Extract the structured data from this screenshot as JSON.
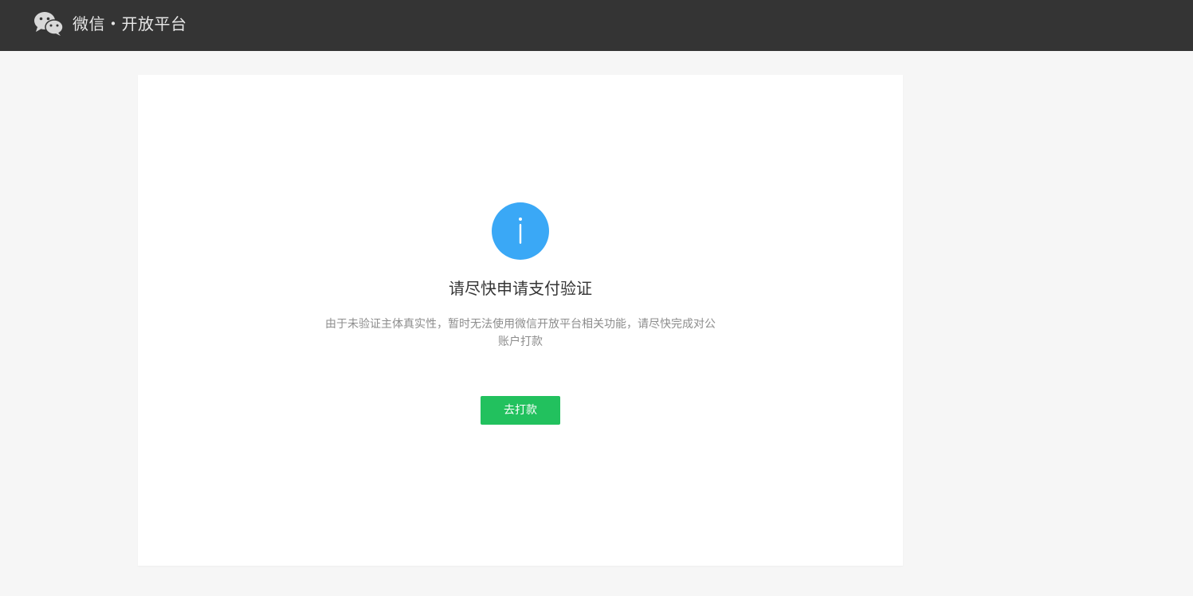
{
  "header": {
    "brand_title": "微信・开放平台",
    "logo_icon": "wechat-logo-icon"
  },
  "notice": {
    "icon": "info-icon",
    "icon_color": "#3aa8f6",
    "title": "请尽快申请支付验证",
    "description": "由于未验证主体真实性，暂时无法使用微信开放平台相关功能，请尽快完成对公账户打款",
    "button_label": "去打款",
    "button_color": "#22c15e"
  }
}
